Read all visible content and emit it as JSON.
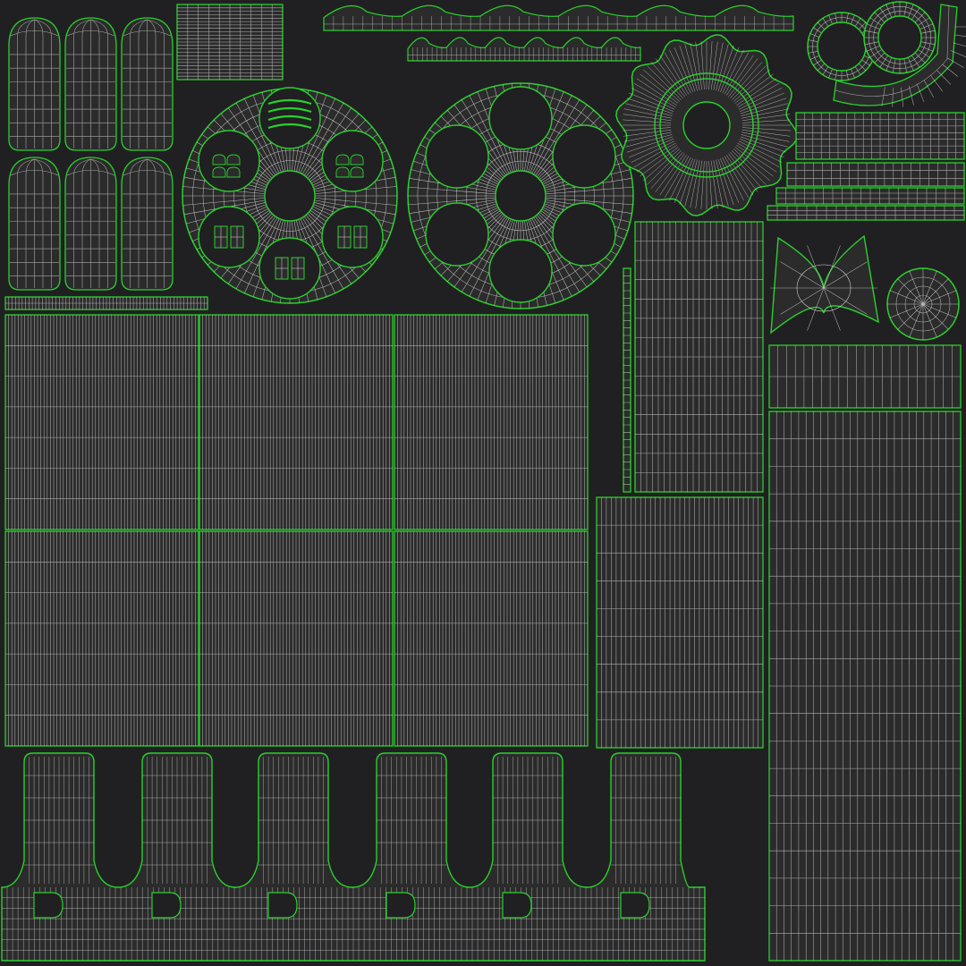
{
  "uv_layout": {
    "background_color": "#202022",
    "island_fill_color": "#2b2b2c",
    "island_border_color": "#29d12b",
    "wire_color": "#dcdcdc",
    "islands": [
      "arch-panel-top-1",
      "arch-panel-top-2",
      "arch-panel-top-3",
      "arch-panel-bottom-1",
      "arch-panel-bottom-2",
      "arch-panel-bottom-3",
      "small-grid-block",
      "wavy-strip-long",
      "wavy-strip-short",
      "ring-small",
      "ring-large",
      "curved-band",
      "rosette-plate",
      "wheel-plate",
      "fluted-disc",
      "stacked-strips",
      "thin-strip-left",
      "large-panel-1",
      "large-panel-2",
      "large-panel-3",
      "large-panel-4",
      "large-panel-5",
      "large-panel-6",
      "vertical-strip-panel",
      "thin-vertical-strip",
      "bowtie-piece",
      "round-cap",
      "right-header-panel",
      "right-tall-panel",
      "lower-middle-panel",
      "crenellated-panel"
    ]
  }
}
